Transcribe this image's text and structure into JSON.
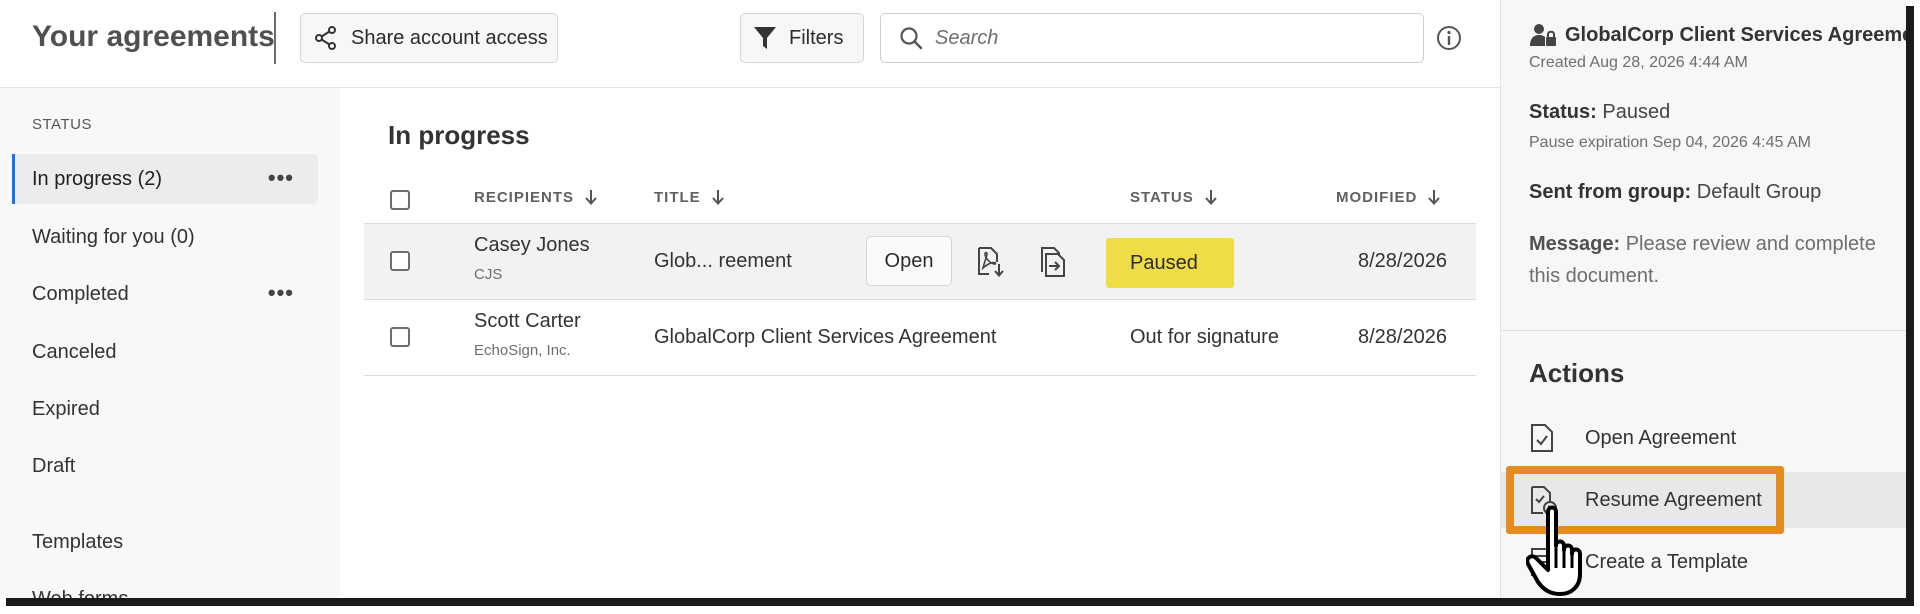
{
  "header": {
    "title": "Your agreements",
    "share_label": "Share account access",
    "filters_label": "Filters",
    "search_placeholder": "Search"
  },
  "sidebar": {
    "heading": "STATUS",
    "items": [
      {
        "label": "In progress (2)",
        "active": true,
        "more": "•••"
      },
      {
        "label": "Waiting for you (0)"
      },
      {
        "label": "Completed",
        "more": "•••"
      },
      {
        "label": "Canceled"
      },
      {
        "label": "Expired"
      },
      {
        "label": "Draft"
      },
      {
        "label": "Templates"
      },
      {
        "label": "Web forms"
      }
    ]
  },
  "main": {
    "section_title": "In progress",
    "columns": [
      "RECIPIENTS",
      "TITLE",
      "STATUS",
      "MODIFIED"
    ],
    "rows": [
      {
        "recipient": "Casey Jones",
        "recipient_sub": "CJS",
        "title": "Glob... reement",
        "open_label": "Open",
        "status": "Paused",
        "modified": "8/28/2026"
      },
      {
        "recipient": "Scott Carter",
        "recipient_sub": "EchoSign, Inc.",
        "title": "GlobalCorp Client Services Agreement",
        "status": "Out for signature",
        "modified": "8/28/2026"
      }
    ]
  },
  "panel": {
    "title": "GlobalCorp Client Services Agreement",
    "created": "Created Aug 28, 2026 4:44 AM",
    "status_label": "Status:",
    "status_value": "Paused",
    "pause_expiration": "Pause expiration Sep 04, 2026 4:45 AM",
    "group_label": "Sent from group:",
    "group_value": "Default Group",
    "message_label": "Message:",
    "message_value": "Please review and complete this document.",
    "actions_heading": "Actions",
    "actions": [
      {
        "label": "Open Agreement"
      },
      {
        "label": "Resume Agreement"
      },
      {
        "label": "Create a Template"
      }
    ]
  },
  "colors": {
    "accent": "#1473e6",
    "paused_badge": "#efdd48",
    "highlight_box": "#e48c1f"
  },
  "icons": [
    "share-icon",
    "filter-icon",
    "search-icon",
    "info-icon",
    "sort-down-icon",
    "pdf-download-icon",
    "move-file-icon",
    "user-lock-icon",
    "document-check-icon",
    "resume-document-icon",
    "template-icon",
    "hand-cursor-icon"
  ]
}
